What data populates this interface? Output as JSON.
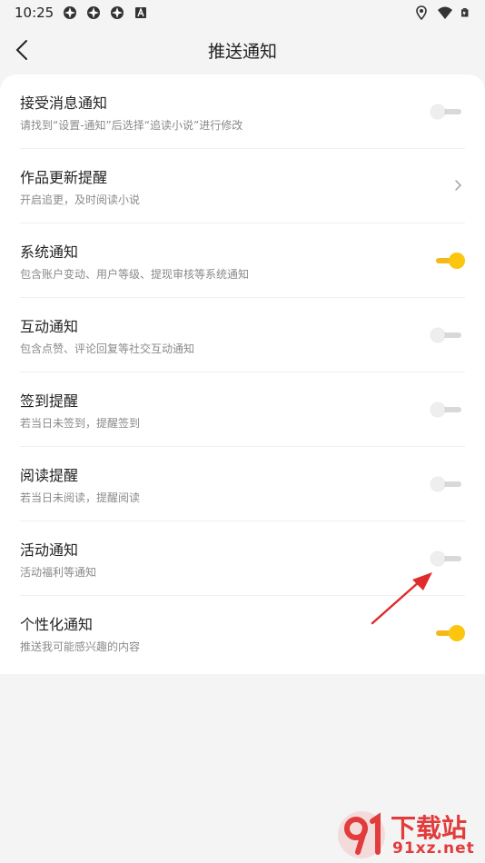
{
  "status_bar": {
    "time": "10:25",
    "icons_left": [
      "app-notification-icon",
      "app-notification-icon",
      "app-notification-icon",
      "accessibility-a-icon"
    ],
    "icons_right": [
      "location-icon",
      "wifi-icon",
      "battery-charging-icon"
    ]
  },
  "header": {
    "title": "推送通知",
    "back_icon": "chevron-left-icon"
  },
  "settings": [
    {
      "title": "接受消息通知",
      "subtitle": "请找到“设置-通知”后选择“追读小说”进行修改",
      "control": "toggle",
      "on": false
    },
    {
      "title": "作品更新提醒",
      "subtitle": "开启追更，及时阅读小说",
      "control": "chevron",
      "icon": "chevron-right-icon"
    },
    {
      "title": "系统通知",
      "subtitle": "包含账户变动、用户等级、提现审核等系统通知",
      "control": "toggle",
      "on": true
    },
    {
      "title": "互动通知",
      "subtitle": "包含点赞、评论回复等社交互动通知",
      "control": "toggle",
      "on": false
    },
    {
      "title": "签到提醒",
      "subtitle": "若当日未签到，提醒签到",
      "control": "toggle",
      "on": false
    },
    {
      "title": "阅读提醒",
      "subtitle": "若当日未阅读，提醒阅读",
      "control": "toggle",
      "on": false
    },
    {
      "title": "活动通知",
      "subtitle": "活动福利等通知",
      "control": "toggle",
      "on": false
    },
    {
      "title": "个性化通知",
      "subtitle": "推送我可能感兴趣的内容",
      "control": "toggle",
      "on": true
    }
  ],
  "colors": {
    "toggle_on": "#fcc50e",
    "toggle_off": "#d9d9d9",
    "annotation_arrow": "#e02b2b"
  },
  "watermark": {
    "text": "下载站",
    "url": "91xz.net",
    "logo": "91-logo-icon"
  }
}
